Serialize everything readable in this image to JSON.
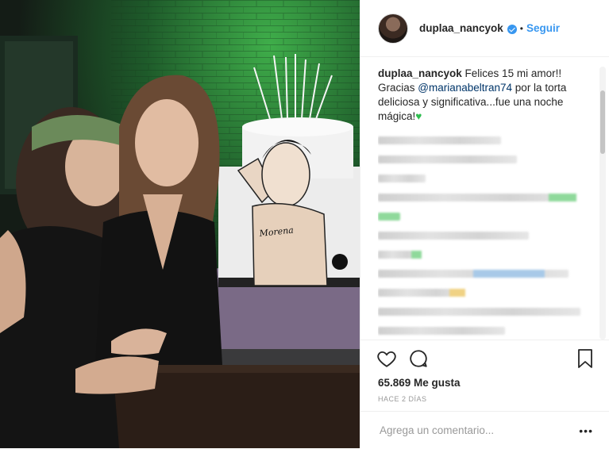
{
  "post": {
    "username": "duplaa_nancyok",
    "follow_label": "Seguir",
    "dot": "•",
    "caption": {
      "username": "duplaa_nancyok",
      "text_before": " Felices 15 mi amor!! Gracias ",
      "mention": "@marianabeltran74",
      "text_after": " por la torta deliciosa y significativa...fue una noche mágica!",
      "emoji": "♥"
    },
    "likes": "65.869 Me gusta",
    "time": "HACE 2 DÍAS",
    "comment_placeholder": "Agrega un comentario...",
    "more_label": "•••",
    "cake_name": "Morena"
  },
  "icons": {
    "like": "heart-icon",
    "comment": "comment-icon",
    "save": "bookmark-icon",
    "verified": "verified-badge-icon"
  },
  "colors": {
    "link": "#3897f0",
    "mention": "#003569",
    "text": "#262626",
    "muted": "#999999"
  }
}
